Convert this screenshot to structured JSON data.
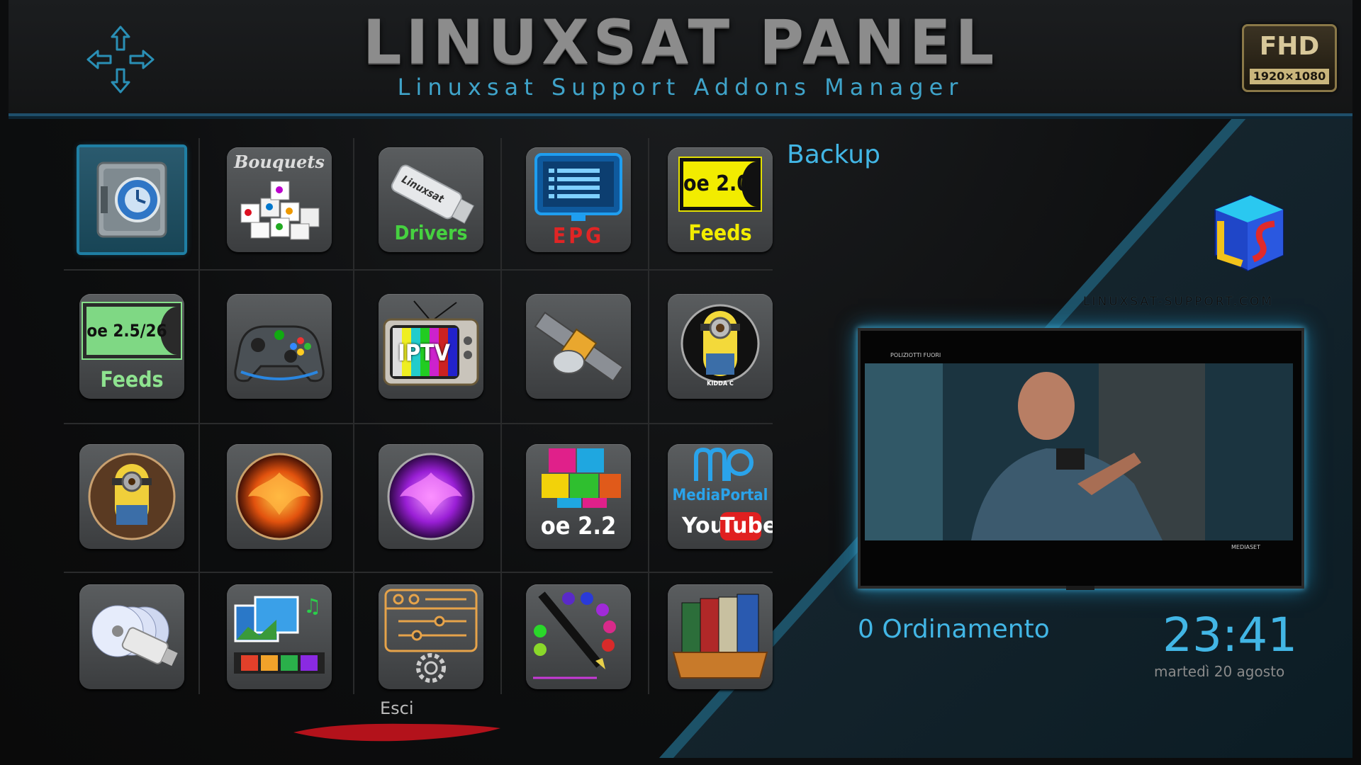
{
  "header": {
    "title": "LINUXSAT PANEL",
    "subtitle": "Linuxsat Support Addons Manager",
    "badge_main": "FHD",
    "badge_sub": "1920×1080"
  },
  "tiles": [
    {
      "name": "backup",
      "label": ""
    },
    {
      "name": "bouquets",
      "label": "Bouquets"
    },
    {
      "name": "drivers",
      "label": "Drivers",
      "sub": "Linuxsat"
    },
    {
      "name": "epg",
      "label": "EPG"
    },
    {
      "name": "feeds-oe20",
      "label": "Feeds",
      "badge": "oe 2.0"
    },
    {
      "name": "feeds-oe25",
      "label": "Feeds",
      "badge": "oe 2.5/26"
    },
    {
      "name": "games",
      "label": ""
    },
    {
      "name": "iptv",
      "label": "IPTV"
    },
    {
      "name": "satellite",
      "label": ""
    },
    {
      "name": "kiddac",
      "label": "KIDDA C"
    },
    {
      "name": "minion",
      "label": ""
    },
    {
      "name": "phoenix-orange",
      "label": ""
    },
    {
      "name": "phoenix-purple",
      "label": ""
    },
    {
      "name": "plugins-oe22",
      "label": "oe 2.2"
    },
    {
      "name": "mediaportal",
      "label": "MediaPortal",
      "label2": "You",
      "label3": "Tube"
    },
    {
      "name": "usb-media",
      "label": ""
    },
    {
      "name": "media-gallery",
      "label": ""
    },
    {
      "name": "settings",
      "label": ""
    },
    {
      "name": "skins",
      "label": ""
    },
    {
      "name": "library",
      "label": ""
    }
  ],
  "selected_label": "Backup",
  "logo_url": "LINUXSAT-SUPPORT.COM",
  "preview": {
    "channel_text": "POLIZIOTTI FUORI",
    "watermark": "MEDIASET"
  },
  "footer": {
    "sort_label": "0 Ordinamento",
    "time": "23:41",
    "date": "martedì 20 agosto",
    "exit_label": "Esci"
  },
  "colors": {
    "accent": "#42b6e5",
    "selection": "#1f7fa4",
    "exit_underline": "#b3121b"
  }
}
